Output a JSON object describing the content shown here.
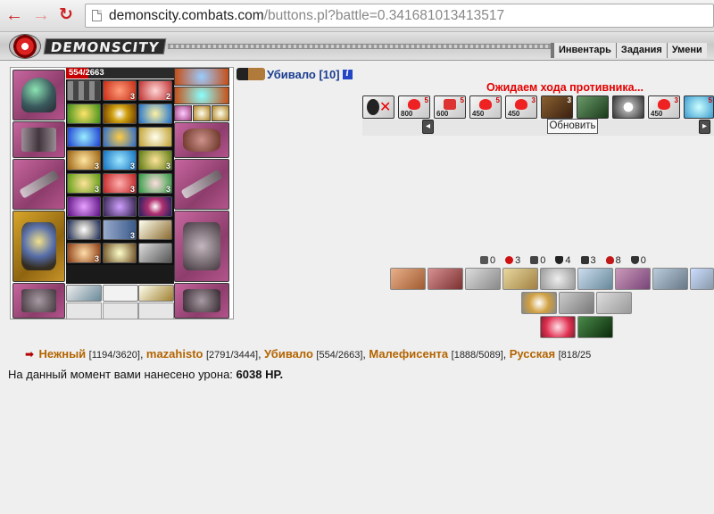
{
  "browser": {
    "url_host": "demonscity.combats.com",
    "url_path": "/buttons.pl?battle=0.341681013413517"
  },
  "header": {
    "logo": "DEMONSCITY",
    "menu": [
      "Инвентарь",
      "Задания",
      "Умени"
    ]
  },
  "character": {
    "hp_current": 554,
    "hp_max": 2663,
    "hp_text": "554/2663",
    "belt_counts": [
      "3",
      "2",
      "3",
      "3",
      "3",
      "3",
      "3",
      "3",
      "3",
      "3",
      "3"
    ]
  },
  "battle": {
    "player_name": "Убивало [10]",
    "info_icon": "i",
    "wait_text": "Ожидаем хода противника...",
    "refresh_label": "Обновить",
    "enemies": [
      {
        "num": "",
        "sub": ""
      },
      {
        "num": "5",
        "sub": "800"
      },
      {
        "num": "5",
        "sub": "600"
      },
      {
        "num": "5",
        "sub": "450"
      },
      {
        "num": "3",
        "sub": "450"
      },
      {
        "num": "3",
        "sub": ""
      },
      {
        "num": "",
        "sub": ""
      },
      {
        "num": "",
        "sub": ""
      },
      {
        "num": "3",
        "sub": "450"
      },
      {
        "num": "5",
        "sub": ""
      }
    ],
    "stats": [
      {
        "icon": "sword-icon",
        "value": "0",
        "color": "#444444"
      },
      {
        "icon": "blood-icon",
        "value": "3",
        "color": "#d01010"
      },
      {
        "icon": "counter-icon",
        "value": "0",
        "color": "#444444"
      },
      {
        "icon": "shield-icon",
        "value": "4",
        "color": "#222222"
      },
      {
        "icon": "cross-icon",
        "value": "3",
        "color": "#333333"
      },
      {
        "icon": "heart-icon",
        "value": "8",
        "color": "#c01818"
      },
      {
        "icon": "block-icon",
        "value": "0",
        "color": "#333333"
      }
    ]
  },
  "team": {
    "members": [
      {
        "name": "Нежный",
        "hp": "[1194/3620]",
        "sep": ", "
      },
      {
        "name": "mazahisto",
        "hp": "[2791/3444]",
        "sep": ", "
      },
      {
        "name": "Убивало",
        "hp": "[554/2663]",
        "sep": ", "
      },
      {
        "name": "Малефисента",
        "hp": "[1888/5089]",
        "sep": ", "
      },
      {
        "name": "Русская",
        "hp": "[818/25",
        "sep": ""
      }
    ],
    "damage_label": "На данный момент вами нанесено урона:",
    "damage_value": "6038 HP."
  }
}
